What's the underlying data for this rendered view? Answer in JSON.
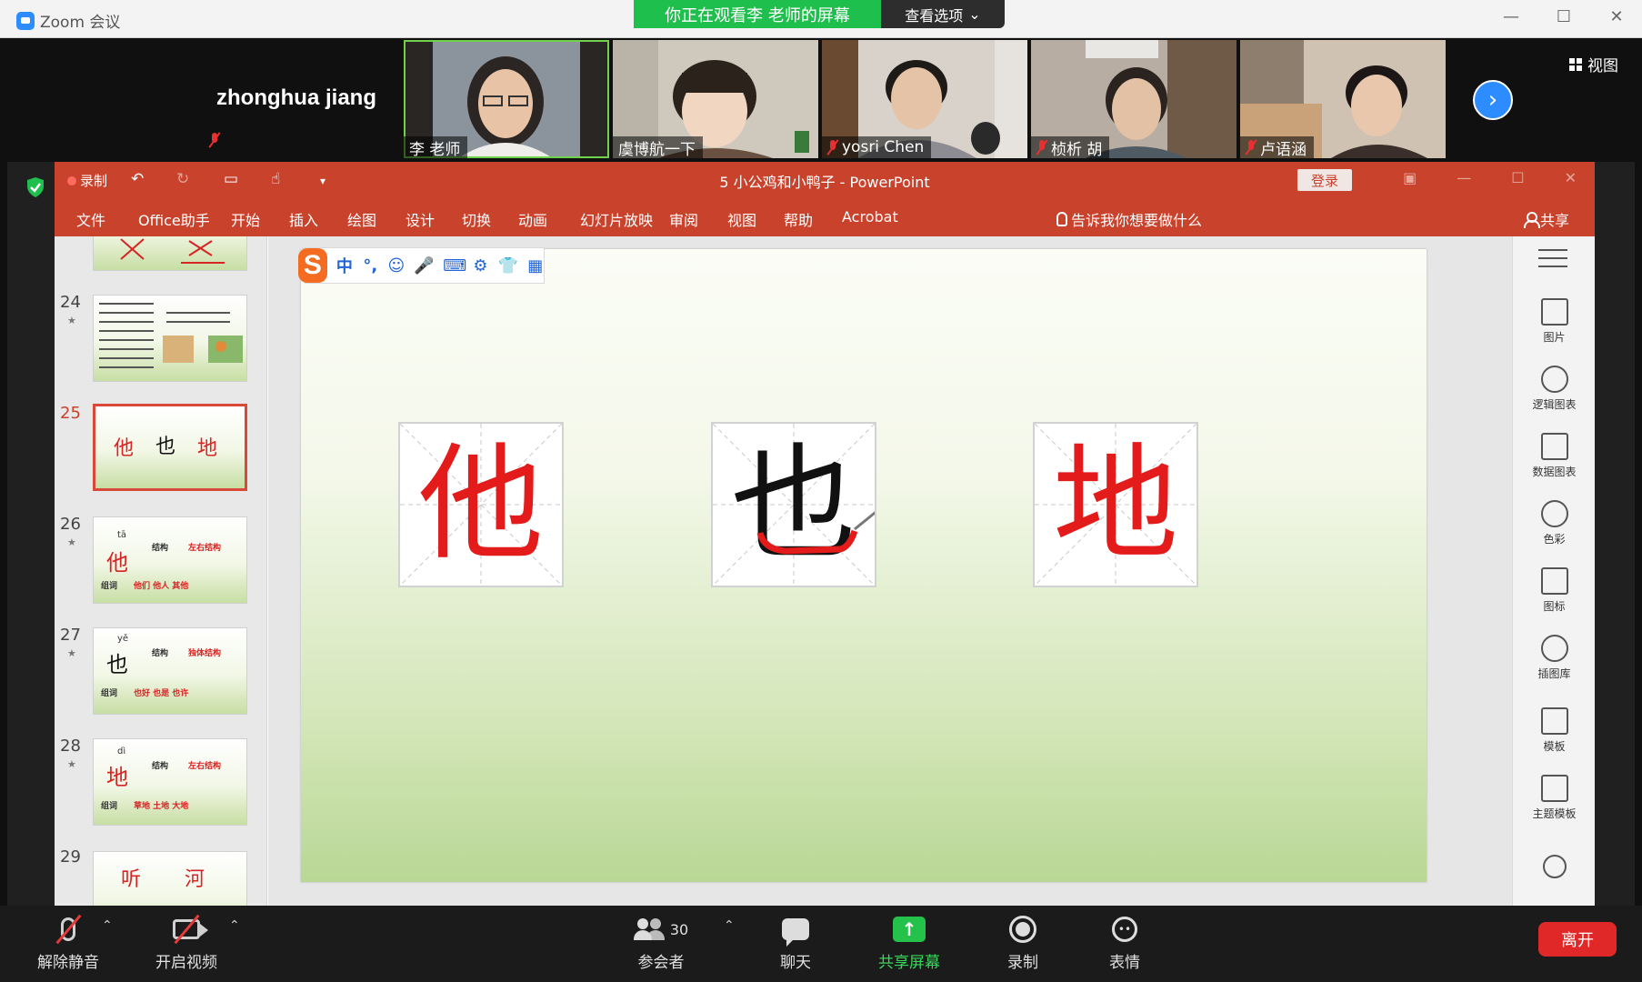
{
  "zoom": {
    "app_title": "Zoom 会议",
    "banner": "你正在观看李 老师的屏幕",
    "view_options": "查看选项",
    "view_button": "视图",
    "host_name": "zhonghua jiang",
    "participants": [
      {
        "name": "李 老师",
        "muted": false,
        "active": true
      },
      {
        "name": "虞博航一下",
        "muted": false,
        "active": false
      },
      {
        "name": "yosri Chen",
        "muted": true,
        "active": false
      },
      {
        "name": "桢析 胡",
        "muted": true,
        "active": false
      },
      {
        "name": "卢语涵",
        "muted": true,
        "active": false
      }
    ]
  },
  "ppt": {
    "record_label": "录制",
    "doc_title": "5 小公鸡和小鸭子  -  PowerPoint",
    "login": "登录",
    "ribbon_tabs": [
      "文件",
      "Office助手",
      "开始",
      "插入",
      "绘图",
      "设计",
      "切换",
      "动画",
      "幻灯片放映",
      "审阅",
      "视图",
      "帮助",
      "Acrobat"
    ],
    "tell_me": "告诉我你想要做什么",
    "share": "共享",
    "thumbnails": [
      {
        "num": "24"
      },
      {
        "num": "25",
        "chars": [
          "他",
          "也",
          "地"
        ]
      },
      {
        "num": "26",
        "pinyin": "tā",
        "char": "他",
        "jiegou": "结构",
        "jiegou_value": "左右结构",
        "zuci": "组词",
        "words": "他们  他人  其他"
      },
      {
        "num": "27",
        "pinyin": "yě",
        "char": "也",
        "jiegou": "结构",
        "jiegou_value": "独体结构",
        "zuci": "组词",
        "words": "也好  也是  也许"
      },
      {
        "num": "28",
        "pinyin": "dì",
        "char": "地",
        "jiegou": "结构",
        "jiegou_value": "左右结构",
        "zuci": "组词",
        "words": "草地  土地  大地"
      },
      {
        "num": "29",
        "chars": [
          "听",
          "河"
        ]
      }
    ],
    "slide_chars": [
      "他",
      "也",
      "地"
    ],
    "ime": {
      "items": [
        "中",
        "°,",
        "☺",
        "🎤",
        "⌨",
        "⚙",
        "👕",
        "▦"
      ],
      "logo": "S"
    },
    "task_pane": [
      "图片",
      "逻辑图表",
      "数据图表",
      "色彩",
      "图标",
      "插图库",
      "模板",
      "主题模板"
    ]
  },
  "toolbar": {
    "unmute": "解除静音",
    "start_video": "开启视频",
    "participants_count": "30",
    "participants": "参会者",
    "chat": "聊天",
    "share_screen": "共享屏幕",
    "record": "录制",
    "reactions": "表情",
    "leave": "离开"
  }
}
